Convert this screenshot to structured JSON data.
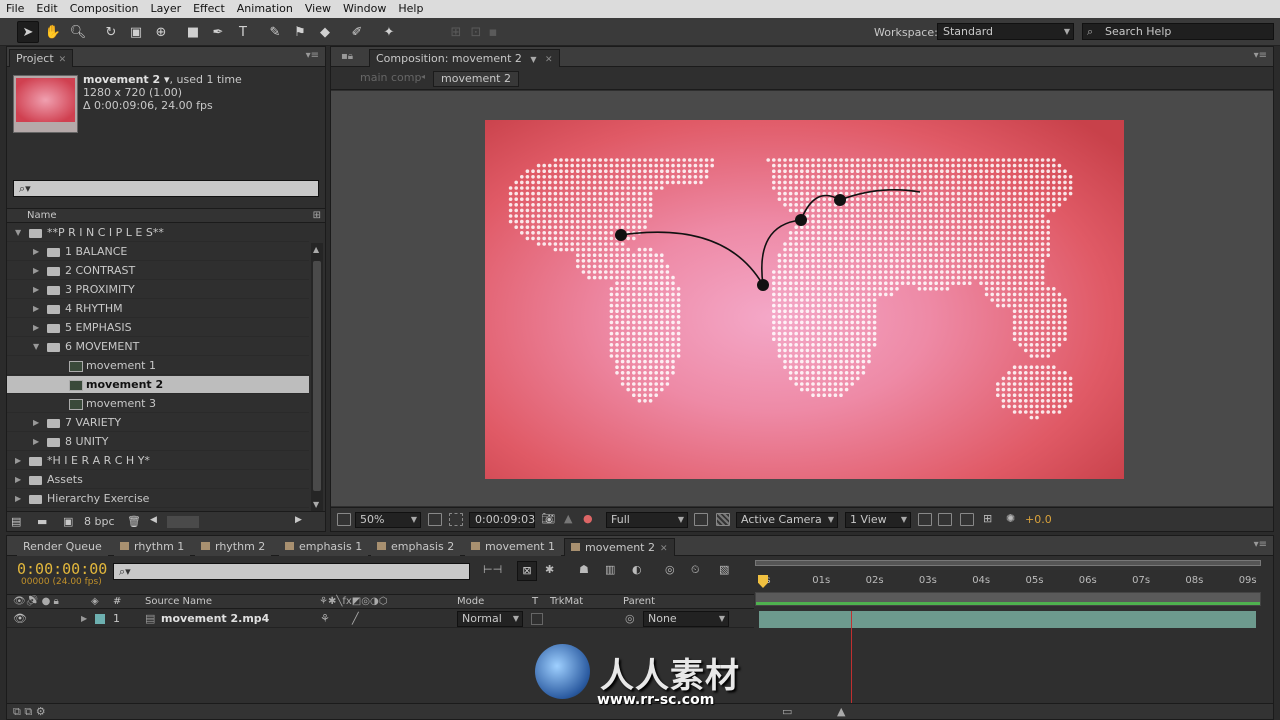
{
  "menu": [
    "File",
    "Edit",
    "Composition",
    "Layer",
    "Effect",
    "Animation",
    "View",
    "Window",
    "Help"
  ],
  "toolbar": {
    "workspace_label": "Workspace:",
    "workspace_value": "Standard",
    "search_placeholder": "Search Help"
  },
  "project": {
    "tab": "Project",
    "item_name": "movement 2",
    "item_used": ", used 1 time",
    "item_res": "1280 x 720 (1.00)",
    "item_dur": "Δ 0:00:09:06, 24.00 fps",
    "search_value": "",
    "col_name": "Name",
    "tree": [
      {
        "label": "**P R I N C I P L E S**",
        "type": "folder",
        "depth": 0,
        "open": true
      },
      {
        "label": "1 BALANCE",
        "type": "folder",
        "depth": 1,
        "open": false
      },
      {
        "label": "2 CONTRAST",
        "type": "folder",
        "depth": 1,
        "open": false
      },
      {
        "label": "3 PROXIMITY",
        "type": "folder",
        "depth": 1,
        "open": false
      },
      {
        "label": "4 RHYTHM",
        "type": "folder",
        "depth": 1,
        "open": false
      },
      {
        "label": "5 EMPHASIS",
        "type": "folder",
        "depth": 1,
        "open": false
      },
      {
        "label": "6 MOVEMENT",
        "type": "folder",
        "depth": 1,
        "open": true
      },
      {
        "label": "movement 1",
        "type": "comp",
        "depth": 2
      },
      {
        "label": "movement 2",
        "type": "comp",
        "depth": 2,
        "selected": true
      },
      {
        "label": "movement 3",
        "type": "comp",
        "depth": 2
      },
      {
        "label": "7 VARIETY",
        "type": "folder",
        "depth": 1,
        "open": false
      },
      {
        "label": "8 UNITY",
        "type": "folder",
        "depth": 1,
        "open": false
      },
      {
        "label": "*H I E R A R C H Y*",
        "type": "folder",
        "depth": 0,
        "open": false
      },
      {
        "label": "Assets",
        "type": "folder",
        "depth": 0,
        "open": false
      },
      {
        "label": "Hierarchy Exercise",
        "type": "folder",
        "depth": 0,
        "open": false
      }
    ],
    "bpc": "8 bpc"
  },
  "composition": {
    "tab": "Composition: movement 2",
    "crumbs": [
      "main comp",
      "movement 2"
    ],
    "zoom": "50%",
    "timecode": "0:00:09:03",
    "resolution": "Full",
    "camera": "Active Camera",
    "views": "1 View",
    "exposure": "+0.0"
  },
  "timeline": {
    "tabs": [
      "Render Queue",
      "rhythm 1",
      "rhythm 2",
      "emphasis 1",
      "emphasis 2",
      "movement 1",
      "movement 2"
    ],
    "active_tab": "movement 2",
    "timecode": "0:00:00:00",
    "timecode_sub": "00000 (24.00 fps)",
    "search_value": "",
    "cols": {
      "num": "#",
      "source": "Source Name",
      "mode": "Mode",
      "t": "T",
      "trkmat": "TrkMat",
      "parent": "Parent"
    },
    "layer": {
      "num": "1",
      "name": "movement 2.mp4",
      "mode": "Normal",
      "parent": "None"
    },
    "ruler": [
      "0s",
      "01s",
      "02s",
      "03s",
      "04s",
      "05s",
      "06s",
      "07s",
      "08s",
      "09s"
    ]
  },
  "watermark": {
    "cn": "人人素材",
    "url": "www.rr-sc.com"
  },
  "colors": {
    "timecode": "#e2b73c",
    "bg_inner": "#f4a8c8",
    "bg_outer": "#c8414a",
    "layer_bar": "#6d9a8e"
  }
}
